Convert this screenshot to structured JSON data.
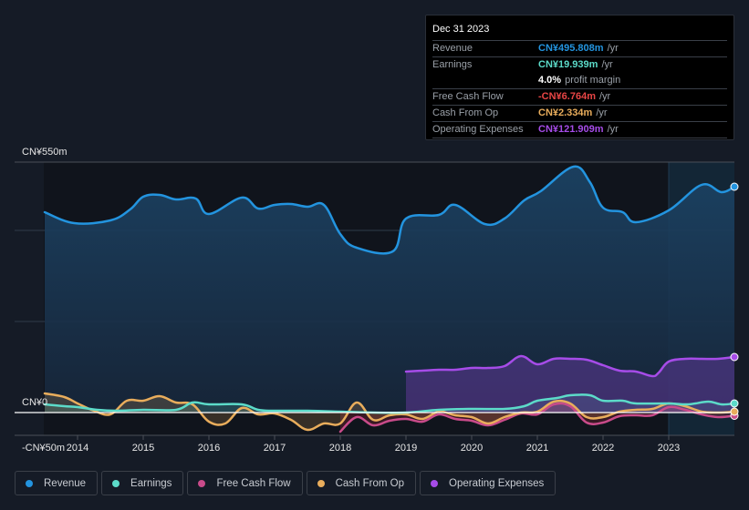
{
  "tooltip": {
    "date": "Dec 31 2023",
    "rows": [
      {
        "label": "Revenue",
        "value": "CN¥495.808m",
        "unit": "/yr",
        "color": "#2394df"
      },
      {
        "label": "Earnings",
        "value": "CN¥19.939m",
        "unit": "/yr",
        "color": "#5cdbc9"
      },
      {
        "label": "",
        "value": "4.0%",
        "unit": "profit margin",
        "color": "#ffffff"
      },
      {
        "label": "Free Cash Flow",
        "value": "-CN¥6.764m",
        "unit": "/yr",
        "color": "#e84545"
      },
      {
        "label": "Cash From Op",
        "value": "CN¥2.334m",
        "unit": "/yr",
        "color": "#e9ad5c"
      },
      {
        "label": "Operating Expenses",
        "value": "CN¥121.909m",
        "unit": "/yr",
        "color": "#a64ce8"
      }
    ]
  },
  "legend": [
    {
      "label": "Revenue",
      "color": "#2394df"
    },
    {
      "label": "Earnings",
      "color": "#5cdbc9"
    },
    {
      "label": "Free Cash Flow",
      "color": "#c94b8a"
    },
    {
      "label": "Cash From Op",
      "color": "#e9ad5c"
    },
    {
      "label": "Operating Expenses",
      "color": "#a64ce8"
    }
  ],
  "chart_data": {
    "type": "area",
    "title": "",
    "xlabel": "",
    "ylabel": "",
    "y_tick_labels": [
      {
        "value": 550,
        "label": "CN¥550m"
      },
      {
        "value": 0,
        "label": "CN¥0"
      },
      {
        "value": -50,
        "label": "-CN¥50m"
      }
    ],
    "ylim": [
      -50,
      550
    ],
    "xlim": [
      2013.5,
      2024.0
    ],
    "x_ticks": [
      2014,
      2015,
      2016,
      2017,
      2018,
      2019,
      2020,
      2021,
      2022,
      2023
    ],
    "gridlines": [
      400,
      200
    ],
    "highlight_from": 2023.0,
    "series": [
      {
        "name": "Revenue",
        "color": "#2394df",
        "points": [
          [
            2013.5,
            440
          ],
          [
            2013.95,
            416
          ],
          [
            2014.5,
            422
          ],
          [
            2014.8,
            446
          ],
          [
            2015.0,
            474
          ],
          [
            2015.25,
            478
          ],
          [
            2015.5,
            468
          ],
          [
            2015.8,
            470
          ],
          [
            2016.0,
            436
          ],
          [
            2016.5,
            472
          ],
          [
            2016.75,
            448
          ],
          [
            2017.0,
            456
          ],
          [
            2017.25,
            458
          ],
          [
            2017.5,
            452
          ],
          [
            2017.75,
            456
          ],
          [
            2018.0,
            392
          ],
          [
            2018.25,
            362
          ],
          [
            2018.8,
            354
          ],
          [
            2019.0,
            426
          ],
          [
            2019.5,
            434
          ],
          [
            2019.75,
            456
          ],
          [
            2020.2,
            414
          ],
          [
            2020.5,
            426
          ],
          [
            2020.8,
            466
          ],
          [
            2021.05,
            486
          ],
          [
            2021.55,
            540
          ],
          [
            2021.8,
            506
          ],
          [
            2022.0,
            450
          ],
          [
            2022.3,
            440
          ],
          [
            2022.5,
            418
          ],
          [
            2023.0,
            444
          ],
          [
            2023.5,
            500
          ],
          [
            2023.8,
            484
          ],
          [
            2024.0,
            496
          ]
        ]
      },
      {
        "name": "Earnings",
        "color": "#5cdbc9",
        "points": [
          [
            2013.5,
            18
          ],
          [
            2013.8,
            14
          ],
          [
            2014.0,
            12
          ],
          [
            2014.3,
            6
          ],
          [
            2014.6,
            4
          ],
          [
            2015.0,
            6
          ],
          [
            2015.5,
            6
          ],
          [
            2015.75,
            22
          ],
          [
            2016.0,
            18
          ],
          [
            2016.5,
            18
          ],
          [
            2016.75,
            6
          ],
          [
            2017.0,
            4
          ],
          [
            2017.5,
            4
          ],
          [
            2018.0,
            2
          ],
          [
            2018.5,
            0
          ],
          [
            2019.0,
            0
          ],
          [
            2019.5,
            6
          ],
          [
            2020.0,
            8
          ],
          [
            2020.5,
            8
          ],
          [
            2020.8,
            14
          ],
          [
            2021.0,
            26
          ],
          [
            2021.3,
            32
          ],
          [
            2021.5,
            38
          ],
          [
            2021.8,
            38
          ],
          [
            2022.0,
            26
          ],
          [
            2022.3,
            26
          ],
          [
            2022.5,
            20
          ],
          [
            2023.0,
            20
          ],
          [
            2023.3,
            18
          ],
          [
            2023.6,
            24
          ],
          [
            2023.8,
            18
          ],
          [
            2024.0,
            20
          ]
        ]
      },
      {
        "name": "Free Cash Flow",
        "color": "#c94b8a",
        "points": [
          [
            2018.0,
            -42
          ],
          [
            2018.25,
            -10
          ],
          [
            2018.5,
            -28
          ],
          [
            2018.75,
            -18
          ],
          [
            2019.0,
            -14
          ],
          [
            2019.25,
            -20
          ],
          [
            2019.5,
            -4
          ],
          [
            2019.75,
            -14
          ],
          [
            2020.0,
            -18
          ],
          [
            2020.25,
            -28
          ],
          [
            2020.5,
            -16
          ],
          [
            2020.75,
            -2
          ],
          [
            2021.0,
            -4
          ],
          [
            2021.25,
            18
          ],
          [
            2021.5,
            14
          ],
          [
            2021.75,
            -22
          ],
          [
            2022.0,
            -22
          ],
          [
            2022.25,
            -8
          ],
          [
            2022.5,
            -6
          ],
          [
            2022.75,
            -6
          ],
          [
            2023.0,
            12
          ],
          [
            2023.25,
            6
          ],
          [
            2023.5,
            -4
          ],
          [
            2023.75,
            -10
          ],
          [
            2024.0,
            -7
          ]
        ]
      },
      {
        "name": "Cash From Op",
        "color": "#e9ad5c",
        "points": [
          [
            2013.5,
            42
          ],
          [
            2013.8,
            34
          ],
          [
            2014.0,
            20
          ],
          [
            2014.25,
            4
          ],
          [
            2014.5,
            -4
          ],
          [
            2014.75,
            26
          ],
          [
            2015.0,
            26
          ],
          [
            2015.25,
            36
          ],
          [
            2015.5,
            22
          ],
          [
            2015.75,
            18
          ],
          [
            2016.0,
            -20
          ],
          [
            2016.25,
            -24
          ],
          [
            2016.5,
            10
          ],
          [
            2016.75,
            -4
          ],
          [
            2017.0,
            -2
          ],
          [
            2017.25,
            -16
          ],
          [
            2017.5,
            -38
          ],
          [
            2017.75,
            -24
          ],
          [
            2018.0,
            -24
          ],
          [
            2018.25,
            22
          ],
          [
            2018.5,
            -16
          ],
          [
            2018.75,
            -6
          ],
          [
            2019.0,
            -4
          ],
          [
            2019.25,
            -14
          ],
          [
            2019.5,
            2
          ],
          [
            2019.75,
            -6
          ],
          [
            2020.0,
            -10
          ],
          [
            2020.25,
            -24
          ],
          [
            2020.5,
            -10
          ],
          [
            2020.75,
            0
          ],
          [
            2021.0,
            2
          ],
          [
            2021.25,
            24
          ],
          [
            2021.5,
            20
          ],
          [
            2021.75,
            -10
          ],
          [
            2022.0,
            -10
          ],
          [
            2022.25,
            2
          ],
          [
            2022.5,
            6
          ],
          [
            2022.75,
            8
          ],
          [
            2023.0,
            20
          ],
          [
            2023.25,
            14
          ],
          [
            2023.5,
            2
          ],
          [
            2023.75,
            0
          ],
          [
            2024.0,
            2
          ]
        ]
      },
      {
        "name": "Operating Expenses",
        "color": "#a64ce8",
        "points": [
          [
            2019.0,
            90
          ],
          [
            2019.25,
            92
          ],
          [
            2019.5,
            94
          ],
          [
            2019.75,
            94
          ],
          [
            2020.0,
            98
          ],
          [
            2020.25,
            98
          ],
          [
            2020.5,
            102
          ],
          [
            2020.75,
            124
          ],
          [
            2021.0,
            106
          ],
          [
            2021.25,
            118
          ],
          [
            2021.5,
            118
          ],
          [
            2021.75,
            116
          ],
          [
            2022.0,
            104
          ],
          [
            2022.25,
            92
          ],
          [
            2022.5,
            90
          ],
          [
            2022.75,
            80
          ],
          [
            2022.85,
            88
          ],
          [
            2023.0,
            112
          ],
          [
            2023.25,
            118
          ],
          [
            2023.5,
            118
          ],
          [
            2023.75,
            118
          ],
          [
            2024.0,
            122
          ]
        ]
      }
    ]
  }
}
